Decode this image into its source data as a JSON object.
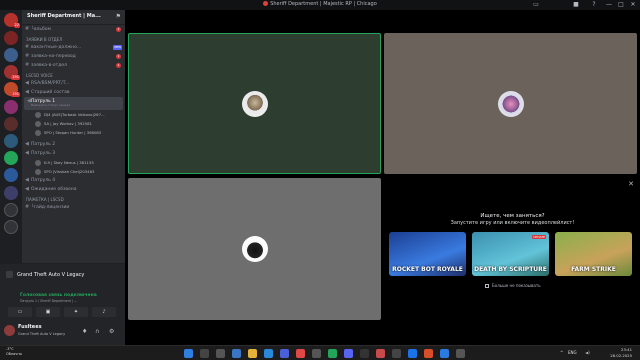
{
  "window": {
    "title": "Sheriff Department | Majestic RP | Chicago"
  },
  "sidebar": {
    "guild_name": "Sheriff Department | Ма...",
    "server_badges": [
      "22",
      "191",
      "191"
    ],
    "channels_top": [
      {
        "label": "└альбом",
        "badge": "1",
        "new": ""
      }
    ],
    "category_requests": "ЗАЯВКИ В ОТДЕЛ",
    "request_channels": [
      {
        "label": "вакантные-должно...",
        "badge": "",
        "new": "NEW"
      },
      {
        "label": "заявка-на-перевод",
        "badge": "1",
        "new": ""
      },
      {
        "label": "заявка-в-отдел",
        "badge": "1",
        "new": ""
      }
    ],
    "category_voice": "LSCSD VOICE",
    "voice_channels": [
      {
        "label": "RSA/BSM/PRT/T...",
        "active": false,
        "sub": ""
      },
      {
        "label": "Старший состав",
        "active": false,
        "sub": ""
      },
      {
        "label": "Патруль 1",
        "active": true,
        "sub": "Выберите статус канала"
      }
    ],
    "patrol1_users": [
      "DJ4 |AUE|Turbask Volkovo|267...",
      "SA | Jay Workov | 392581",
      "SPO | Stepan Hunter | 398083"
    ],
    "patrol_channels_2": [
      {
        "label": "Патруль 2",
        "active": false
      },
      {
        "label": "Патруль 3",
        "active": false
      }
    ],
    "patrol3_users": [
      "K-9 | Skey Nexus | 381135",
      "SPO |Vinskah Chel|203463"
    ],
    "patrol_channels_3": [
      {
        "label": "Патруль 4"
      },
      {
        "label": "Ожидание обзвона"
      }
    ],
    "category_lscsd": "Пажетка | LSCSD",
    "bottom_channels": [
      {
        "label": "└гайд-лицензии"
      }
    ]
  },
  "activity": {
    "game": "Grand Theft Auto V Legacy",
    "voice_status": "Голосовая связь подключена",
    "voice_channel": "Патруль 1 / Sheriff Department | ..."
  },
  "user": {
    "name": "Fusltees",
    "status": "Grand Theft Auto V Legacy"
  },
  "promo": {
    "title": "Ищете, чем заняться?",
    "subtitle": "Запустите игру или включите видеоплейлист!",
    "cards": [
      {
        "name": "ROCKET BOT ROYALE",
        "update": ""
      },
      {
        "name": "DEATH BY SCRIPTURE",
        "update": "UPDATE"
      },
      {
        "name": "FARM STRIKE",
        "update": ""
      }
    ],
    "checkbox_label": "Больше не показывать"
  },
  "taskbar": {
    "weather_temp": "-3°C",
    "weather_text": "Облачно",
    "lang": "ENG",
    "time": "23:41",
    "date": "28.02.2025"
  },
  "colors": {
    "bg": "#000000",
    "sidebar": "#2b2d31",
    "servers": "#1e1f22",
    "speaking": "#23a55a",
    "tile1": "#2d3d2f",
    "tile2": "#6b625c",
    "tile3": "#6e6e6e"
  }
}
